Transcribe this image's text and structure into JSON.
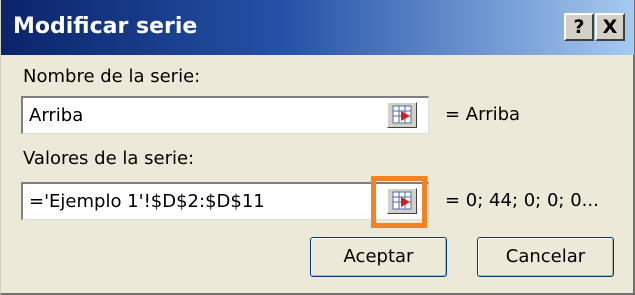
{
  "dialog": {
    "title": "Modificar serie",
    "help_label": "?",
    "close_label": "X"
  },
  "series_name": {
    "label": "Nombre de la serie:",
    "value": "Arriba",
    "preview": "= Arriba"
  },
  "series_values": {
    "label": "Valores de la serie:",
    "value": "='Ejemplo 1'!$D$2:$D$11",
    "preview": "= 0; 44; 0; 0; 0..."
  },
  "buttons": {
    "ok": "Aceptar",
    "cancel": "Cancelar"
  },
  "icons": {
    "collapse": "range-collapse-icon"
  },
  "colors": {
    "highlight": "#f58220",
    "title_bar": "#0a246a",
    "dialog_bg": "#ece9d8"
  }
}
